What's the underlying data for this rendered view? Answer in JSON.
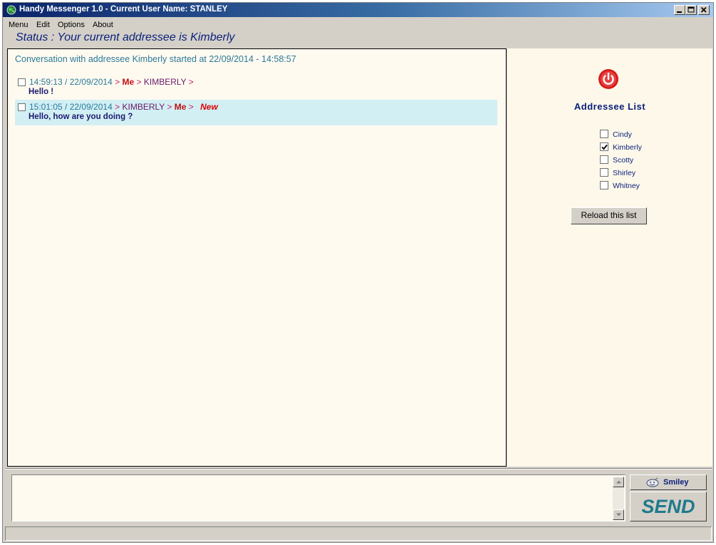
{
  "window": {
    "title": "Handy Messenger 1.0 - Current User Name: STANLEY"
  },
  "menu": {
    "items": [
      "Menu",
      "Edit",
      "Options",
      "About"
    ]
  },
  "status": {
    "text": "Status : Your current addressee is Kimberly"
  },
  "conversation": {
    "header": "Conversation with addressee Kimberly started at 22/09/2014 - 14:58:57",
    "messages": [
      {
        "timestamp": "14:59:13 / 22/09/2014",
        "sep1": ">",
        "from": "Me",
        "sep2": ">",
        "to": "KIMBERLY",
        "sep3": ">",
        "text": "Hello !",
        "new_tag": ""
      },
      {
        "timestamp": "15:01:05 / 22/09/2014",
        "sep1": ">",
        "from": "KIMBERLY",
        "sep2": ">",
        "to": "Me",
        "sep3": ">",
        "text": "Hello, how are you doing ?",
        "new_tag": "New"
      }
    ]
  },
  "addressee": {
    "title": "Addressee List",
    "items": [
      {
        "label": "Cindy",
        "checked": false
      },
      {
        "label": "Kimberly",
        "checked": true
      },
      {
        "label": "Scotty",
        "checked": false
      },
      {
        "label": "Shirley",
        "checked": false
      },
      {
        "label": "Whitney",
        "checked": false
      }
    ],
    "reload_label": "Reload this list"
  },
  "compose": {
    "value": "",
    "smiley_label": "Smiley",
    "send_label": "SEND"
  },
  "icons": {
    "app": "globe-icon",
    "power": "power-icon",
    "smiley": "smiley-icon"
  },
  "colors": {
    "accent": "#0a1f7a",
    "send": "#1f7a8c",
    "power": "#d81c1c",
    "highlight_row": "#d2eff4"
  }
}
